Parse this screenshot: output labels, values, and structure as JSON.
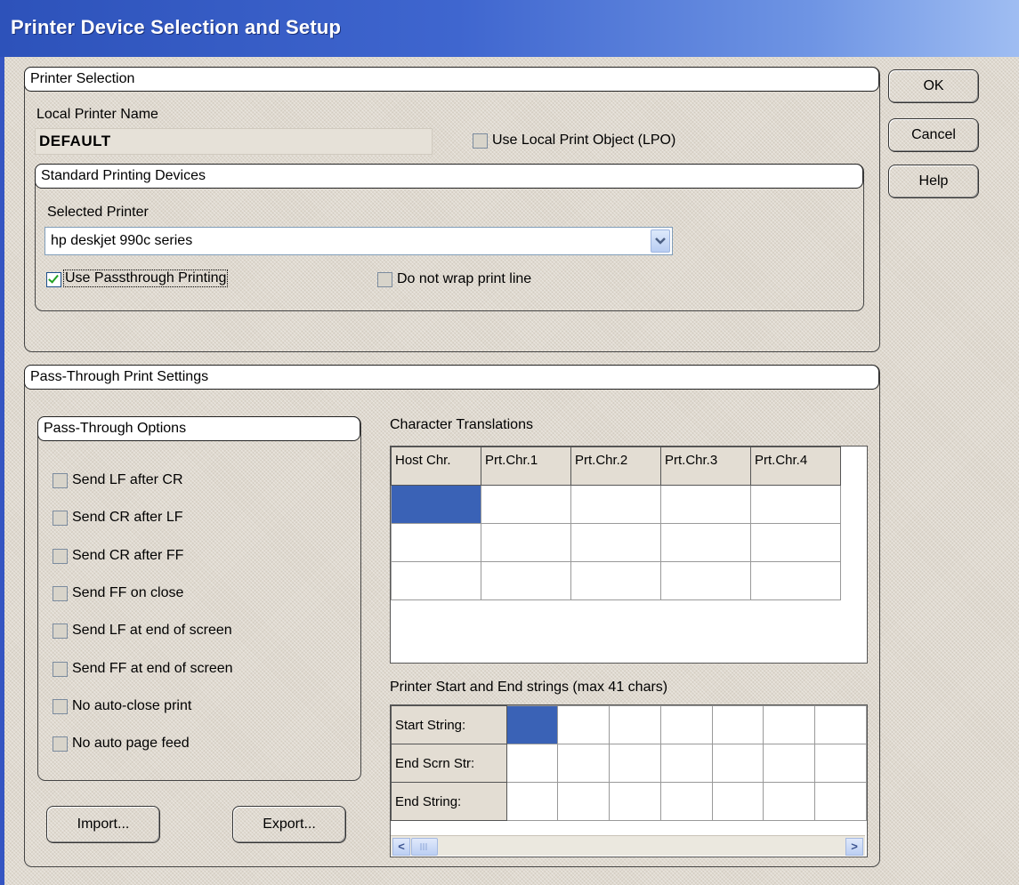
{
  "window": {
    "title": "Printer Device Selection and Setup"
  },
  "buttons": {
    "ok": "OK",
    "cancel": "Cancel",
    "help": "Help",
    "import": "Import...",
    "export": "Export..."
  },
  "printer_selection": {
    "heading": "Printer Selection",
    "local_printer_label": "Local Printer Name",
    "local_printer_value": "DEFAULT",
    "use_lpo_label": "Use Local Print Object (LPO)",
    "use_lpo_checked": false,
    "standard_devices": {
      "heading": "Standard Printing Devices",
      "selected_printer_label": "Selected Printer",
      "selected_printer_value": "hp deskjet 990c series",
      "passthrough_label": "Use Passthrough Printing",
      "passthrough_checked": true,
      "no_wrap_label": "Do not wrap print line",
      "no_wrap_checked": false
    }
  },
  "passthrough_settings": {
    "heading": "Pass-Through Print Settings",
    "options_heading": "Pass-Through Options",
    "options": [
      {
        "label": "Send LF after CR",
        "checked": false
      },
      {
        "label": "Send CR after LF",
        "checked": false
      },
      {
        "label": "Send CR after FF",
        "checked": false
      },
      {
        "label": "Send FF on close",
        "checked": false
      },
      {
        "label": "Send LF at end of screen",
        "checked": false
      },
      {
        "label": "Send FF at end of screen",
        "checked": false
      },
      {
        "label": "No auto-close print",
        "checked": false
      },
      {
        "label": "No auto page feed",
        "checked": false
      }
    ],
    "char_translations_label": "Character Translations",
    "char_columns": [
      "Host Chr.",
      "Prt.Chr.1",
      "Prt.Chr.2",
      "Prt.Chr.3",
      "Prt.Chr.4"
    ],
    "strings_label": "Printer Start and End strings (max 41 chars)",
    "string_rows": [
      "Start String:",
      "End Scrn Str:",
      "End String:"
    ]
  },
  "scrollbar": {
    "left_arrow": "<",
    "right_arrow": ">"
  }
}
